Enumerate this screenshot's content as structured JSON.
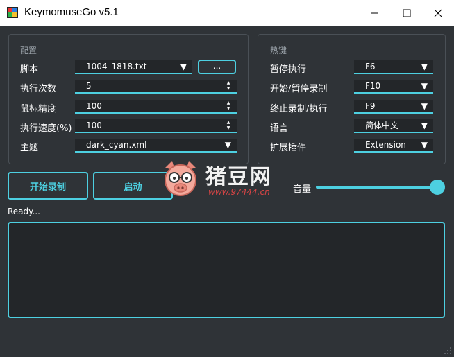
{
  "window": {
    "title": "KeymomuseGo v5.1"
  },
  "config_group": {
    "title": "配置",
    "script_label": "脚本",
    "script_value": "1004_1818.txt",
    "browse_label": "...",
    "run_count_label": "执行次数",
    "run_count_value": "5",
    "mouse_precision_label": "鼠标精度",
    "mouse_precision_value": "100",
    "run_speed_label": "执行速度(%)",
    "run_speed_value": "100",
    "theme_label": "主题",
    "theme_value": "dark_cyan.xml"
  },
  "hotkey_group": {
    "title": "热键",
    "pause_run_label": "暂停执行",
    "pause_run_value": "F6",
    "start_pause_record_label": "开始/暂停录制",
    "start_pause_record_value": "F10",
    "stop_record_run_label": "终止录制/执行",
    "stop_record_run_value": "F9",
    "language_label": "语言",
    "language_value": "简体中文",
    "plugin_label": "扩展插件",
    "plugin_value": "Extension"
  },
  "actions": {
    "start_record_label": "开始录制",
    "launch_label": "启动"
  },
  "volume": {
    "label": "音量",
    "level_percent": 100
  },
  "status": {
    "text": "Ready..."
  },
  "watermark": {
    "brand_text": "猪豆网",
    "url_text": "www.97444.cn"
  },
  "colors": {
    "accent": "#4dd0e1",
    "background": "#2f3337",
    "field_bg": "#232629"
  }
}
